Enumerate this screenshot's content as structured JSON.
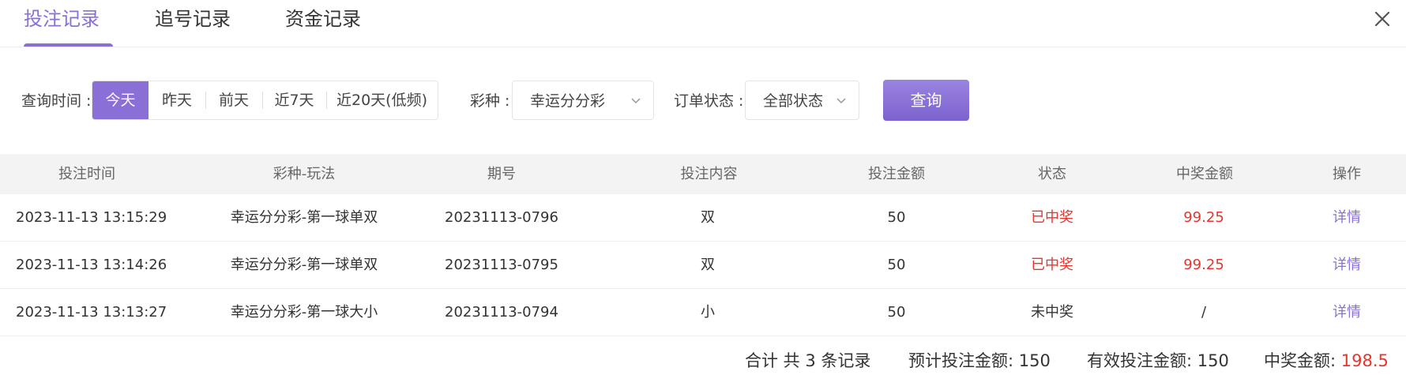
{
  "tabs": [
    {
      "label": "投注记录",
      "active": true
    },
    {
      "label": "追号记录",
      "active": false
    },
    {
      "label": "资金记录",
      "active": false
    }
  ],
  "close_icon": "close-icon",
  "filters": {
    "time_label": "查询时间 :",
    "time_options": [
      "今天",
      "昨天",
      "前天",
      "近7天",
      "近20天(低频)"
    ],
    "time_selected": "今天",
    "lottery_label": "彩种 :",
    "lottery_value": "幸运分分彩",
    "status_label": "订单状态 :",
    "status_value": "全部状态",
    "query_button": "查询"
  },
  "table": {
    "columns": [
      "投注时间",
      "彩种-玩法",
      "期号",
      "投注内容",
      "投注金额",
      "状态",
      "中奖金额",
      "操作"
    ],
    "rows": [
      {
        "time": "2023-11-13 13:15:29",
        "game": "幸运分分彩-第一球单双",
        "issue": "20231113-0796",
        "content": "双",
        "amount": "50",
        "status": "已中奖",
        "win_amount": "99.25",
        "action": "详情",
        "won": true
      },
      {
        "time": "2023-11-13 13:14:26",
        "game": "幸运分分彩-第一球单双",
        "issue": "20231113-0795",
        "content": "双",
        "amount": "50",
        "status": "已中奖",
        "win_amount": "99.25",
        "action": "详情",
        "won": true
      },
      {
        "time": "2023-11-13 13:13:27",
        "game": "幸运分分彩-第一球大小",
        "issue": "20231113-0794",
        "content": "小",
        "amount": "50",
        "status": "未中奖",
        "win_amount": "/",
        "action": "详情",
        "won": false
      }
    ]
  },
  "summary": {
    "total": "合计 共 3 条记录",
    "expected_label": "预计投注金额: ",
    "expected_value": "150",
    "valid_label": "有效投注金额: ",
    "valid_value": "150",
    "win_label": "中奖金额: ",
    "win_value": "198.5"
  },
  "colors": {
    "accent": "#8a6fd6",
    "win": "#e8342c",
    "header_bg": "#f3f3f3"
  }
}
